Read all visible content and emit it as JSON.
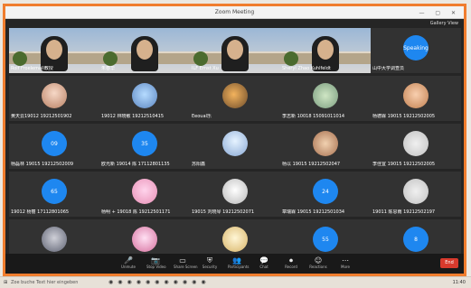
{
  "window": {
    "title": "Zoom Meeting",
    "top_right_label": "Gallery View"
  },
  "participants": [
    {
      "name": "Rolf Froelemall教授",
      "type": "video",
      "palette": "light"
    },
    {
      "name": "朱春华",
      "type": "video",
      "palette": "light"
    },
    {
      "name": "ILF Ernst Xu",
      "type": "video",
      "palette": "light"
    },
    {
      "name": "Sheryl Zhao Kuhlfeldt",
      "type": "video",
      "palette": "light"
    },
    {
      "name": "山中大学调查员",
      "type": "avatar",
      "avatar_label": "Speaking",
      "palette": "blue"
    },
    {
      "name": "黄天云19012 19212501902",
      "type": "avatar",
      "avatar_label": "",
      "palette": "img1"
    },
    {
      "name": "19012 林晓敏 19212510415",
      "type": "avatar",
      "avatar_label": "",
      "palette": "img2"
    },
    {
      "name": "Eeoual乐",
      "type": "avatar",
      "avatar_label": "",
      "palette": "img3"
    },
    {
      "name": "李志新 10018 15091011014",
      "type": "avatar",
      "avatar_label": "",
      "palette": "img4"
    },
    {
      "name": "杨德霖 19015 19212502005",
      "type": "avatar",
      "avatar_label": "",
      "palette": "img5"
    },
    {
      "name": "杨磊林 19015 19212502009",
      "type": "avatar",
      "avatar_label": "09",
      "palette": "blue"
    },
    {
      "name": "欧光新 19014 陈 17112801135",
      "type": "avatar",
      "avatar_label": "35",
      "palette": "blue"
    },
    {
      "name": "苏阳鑫",
      "type": "avatar",
      "avatar_label": "",
      "palette": "img6"
    },
    {
      "name": "杨以 19015 19212502047",
      "type": "avatar",
      "avatar_label": "",
      "palette": "img7"
    },
    {
      "name": "李佳宜 19015 19212502005",
      "type": "avatar",
      "avatar_label": "",
      "palette": "img8"
    },
    {
      "name": "19012 杨丽 17112801065",
      "type": "avatar",
      "avatar_label": "65",
      "palette": "blue"
    },
    {
      "name": "杨明 + 19018 陈 19212501171",
      "type": "avatar",
      "avatar_label": "",
      "palette": "img9"
    },
    {
      "name": "19015 刘晓琴 19212502071",
      "type": "avatar",
      "avatar_label": "",
      "palette": "img10"
    },
    {
      "name": "章瑞霖 19015 19212501034",
      "type": "avatar",
      "avatar_label": "24",
      "palette": "blue"
    },
    {
      "name": "19011 陈思雨 19212502197",
      "type": "avatar",
      "avatar_label": "",
      "palette": "img8"
    },
    {
      "name": "",
      "type": "avatar",
      "avatar_label": "",
      "palette": "img11"
    },
    {
      "name": "",
      "type": "avatar",
      "avatar_label": "",
      "palette": "img12"
    },
    {
      "name": "",
      "type": "avatar",
      "avatar_label": "",
      "palette": "img13"
    },
    {
      "name": "",
      "type": "avatar",
      "avatar_label": "55",
      "palette": "blue"
    },
    {
      "name": "",
      "type": "avatar",
      "avatar_label": "8",
      "palette": "blue"
    }
  ],
  "toolbar": {
    "items": [
      {
        "label": "Unmute",
        "icon": "mic-icon",
        "glyph": "🎤"
      },
      {
        "label": "Stop Video",
        "icon": "camera-icon",
        "glyph": "📷"
      },
      {
        "label": "Share Screen",
        "icon": "share-icon",
        "glyph": "▭"
      },
      {
        "label": "Security",
        "icon": "shield-icon",
        "glyph": "⛨"
      },
      {
        "label": "Participants",
        "icon": "people-icon",
        "glyph": "👥"
      },
      {
        "label": "Chat",
        "icon": "chat-icon",
        "glyph": "💬"
      },
      {
        "label": "Record",
        "icon": "record-icon",
        "glyph": "⏺"
      },
      {
        "label": "Reactions",
        "icon": "reaction-icon",
        "glyph": "☺"
      },
      {
        "label": "More",
        "icon": "more-icon",
        "glyph": "⋯"
      }
    ],
    "leave_label": "End"
  },
  "taskbar": {
    "start_label": "⊞",
    "search_text": "Zoe buche Text hier eingeben",
    "clock": "11:40"
  }
}
